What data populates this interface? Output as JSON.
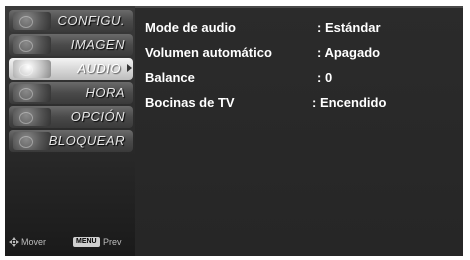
{
  "sidebar": {
    "items": [
      {
        "label": "CONFIGU.",
        "selected": false,
        "icon": "setup-thumbnail-icon"
      },
      {
        "label": "IMAGEN",
        "selected": false,
        "icon": "picture-thumbnail-icon"
      },
      {
        "label": "AUDIO",
        "selected": true,
        "icon": "audio-thumbnail-icon"
      },
      {
        "label": "HORA",
        "selected": false,
        "icon": "time-thumbnail-icon"
      },
      {
        "label": "OPCIÓN",
        "selected": false,
        "icon": "option-thumbnail-icon"
      },
      {
        "label": "BLOQUEAR",
        "selected": false,
        "icon": "lock-thumbnail-icon"
      }
    ]
  },
  "hints": {
    "move_label": "Mover",
    "menu_key": "MENU",
    "prev_label": "Prev"
  },
  "audio_menu": {
    "rows": [
      {
        "name": "Mode de audio",
        "value": ": Estándar"
      },
      {
        "name": "Volumen automático",
        "value": ": Apagado"
      },
      {
        "name": "Balance",
        "value": ": 0"
      },
      {
        "name": "Bocinas de TV",
        "value": ": Encendido"
      }
    ]
  }
}
